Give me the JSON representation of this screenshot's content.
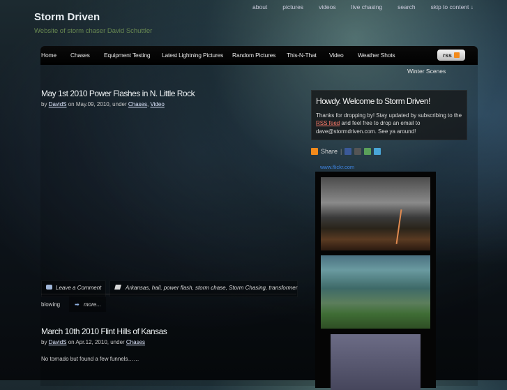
{
  "topnav": [
    "about",
    "pictures",
    "videos",
    "live chasing",
    "search",
    "skip to content ↓"
  ],
  "site": {
    "title": "Storm Driven",
    "tagline": "Website of storm chaser David Schuttler"
  },
  "mainnav": {
    "items": [
      "Home",
      "Chases",
      "Equipment Testing",
      "Latest Lightning Pictures",
      "Random Pictures",
      "This-N-That",
      "Video",
      "Weather Shots"
    ],
    "overflow_item": "Winter Scenes",
    "rss_label": "rss"
  },
  "posts": [
    {
      "title": "May 1st 2010 Power Flashes in N. Little Rock",
      "meta_by": "by",
      "author": "DavidS",
      "meta_on": "on May.09, 2010, under",
      "categories": [
        "Chases",
        "Video"
      ],
      "comment_label": "Leave a Comment",
      "tags_line1": "Arkansas, hail, power flash, storm chase, Storm Chasing, transformer",
      "tags_line2": "blowing",
      "more_label": "more..."
    },
    {
      "title": "March 10th 2010 Flint Hills of Kansas",
      "meta_by": "by",
      "author": "DavidS",
      "meta_on": "on Apr.12, 2010, under",
      "categories": [
        "Chases"
      ],
      "excerpt": "No tornado but found a few funnels……"
    }
  ],
  "sidebar": {
    "welcome_title": "Howdy. Welcome to Storm Driven!",
    "welcome_text_1": "Thanks for dropping by! Stay updated by subscribing to the",
    "rss_feed_link": "RSS feed",
    "welcome_text_2": "and feel free to drop an email to dave@stormdriven.com. See ya around!",
    "share_label": "Share",
    "flickr_label": "www.flickr.com"
  },
  "colors": {
    "accent_link": "#ff7b6a",
    "tagline": "#6a8a52",
    "flickr": "#3e84e0"
  }
}
